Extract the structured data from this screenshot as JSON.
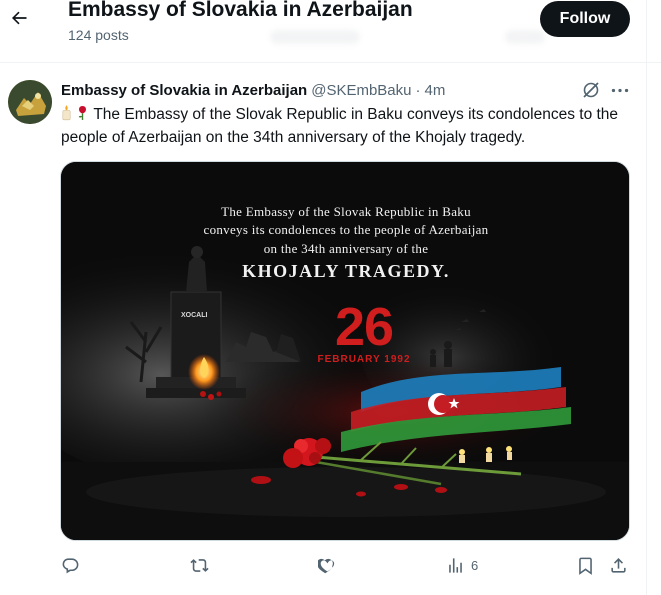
{
  "header": {
    "back_icon": "arrow-left-icon",
    "title": "Embassy of Slovakia in Azerbaijan",
    "posts_count": "124 posts",
    "follow_label": "Follow"
  },
  "tweet": {
    "author_name": "Embassy of Slovakia in Azerbaijan",
    "handle": "@SKEmbBaku",
    "separator": "·",
    "time": "4m",
    "text": "The Embassy of the Slovak Republic in Baku conveys its condolences to the people of Azerbaijan on the 34th anniversary of the Khojaly tragedy.",
    "emojis": [
      "candle-icon",
      "rose-icon"
    ],
    "media": {
      "line1": "The Embassy of the Slovak Republic in Baku",
      "line2": "conveys its condolences to the people of Azerbaijan",
      "line3": "on the 34th anniversary of the",
      "line4": "KHOJALY TRAGEDY.",
      "day": "26",
      "month": "FEBRUARY 1992",
      "monument_label": "XOCALI"
    },
    "actions": {
      "reply_icon": "reply-icon",
      "repost_icon": "repost-icon",
      "like_icon": "heart-icon",
      "views_icon": "views-icon",
      "views_count": "6",
      "bookmark_icon": "bookmark-icon",
      "share_icon": "share-icon"
    }
  },
  "colors": {
    "text": "#0f1419",
    "secondary": "#536471",
    "follow_bg": "#0f1419",
    "accent_red": "#d01d1d"
  }
}
